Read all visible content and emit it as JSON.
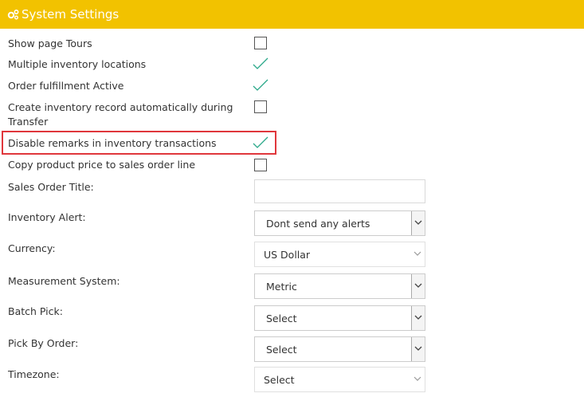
{
  "header": {
    "title": "System Settings",
    "icon": "gears-icon"
  },
  "colors": {
    "header_bg": "#f2c200",
    "check": "#2aa889",
    "highlight": "#e0373c"
  },
  "settings": [
    {
      "label": "Show page Tours",
      "checked": false
    },
    {
      "label": "Multiple inventory locations",
      "checked": true
    },
    {
      "label": "Order fulfillment Active",
      "checked": true
    },
    {
      "label": "Create inventory record automatically during",
      "label2": "Transfer",
      "checked": false
    },
    {
      "label": "Disable remarks in inventory transactions",
      "checked": true
    },
    {
      "label": "Copy product price to sales order line",
      "checked": false
    }
  ],
  "fields": {
    "sales_order_title": {
      "label": "Sales Order Title:",
      "value": ""
    },
    "inventory_alert": {
      "label": "Inventory Alert:",
      "value": "Dont send any alerts"
    },
    "currency": {
      "label": "Currency:",
      "value": "US Dollar"
    },
    "measurement_system": {
      "label": "Measurement System:",
      "value": "Metric"
    },
    "batch_pick": {
      "label": "Batch Pick:",
      "value": "Select"
    },
    "pick_by_order": {
      "label": "Pick By Order:",
      "value": "Select"
    },
    "timezone": {
      "label": "Timezone:",
      "value": "Select"
    }
  }
}
